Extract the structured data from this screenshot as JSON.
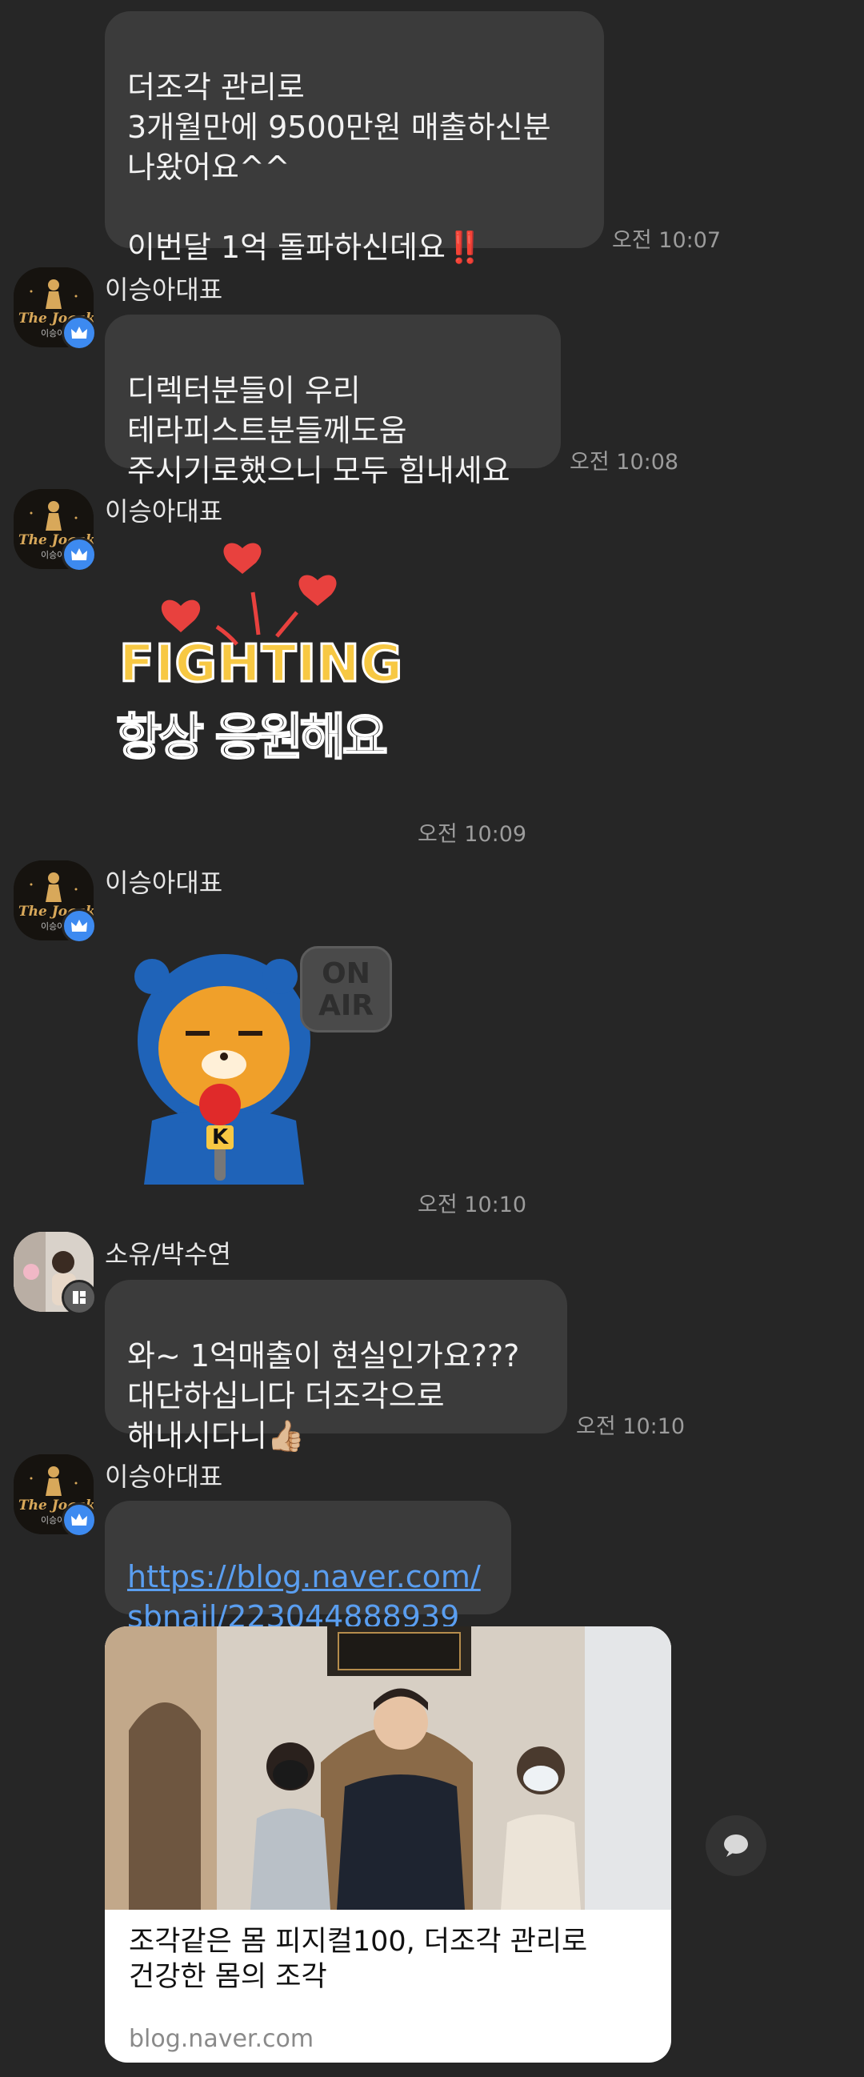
{
  "messages": {
    "m1": {
      "text": "더조각 관리로\n3개월만에 9500만원 매출하신분\n나왔어요^^\n\n이번달 1억 돌파하신데요",
      "emoji": "‼️",
      "time": "오전 10:07"
    },
    "m2": {
      "sender": "이승아대표",
      "text": "디렉터분들이 우리\n테라피스트분들께도움\n주시기로했으니 모두 힘내세요",
      "time": "오전 10:08"
    },
    "m3": {
      "sender": "이승아대표",
      "sticker_title": "FIGHTING",
      "sticker_sub": "항상 응원해요",
      "time": "오전 10:09"
    },
    "m4": {
      "sender": "이승아대표",
      "sticker_sign": "ON\nAIR",
      "sticker_mic_letter": "K",
      "time": "오전 10:10"
    },
    "m5": {
      "sender": "소유/박수연",
      "text": "와~ 1억매출이 현실인가요???\n대단하십니다 더조각으로\n해내시다니",
      "emoji": "👍🏼",
      "time": "오전 10:10"
    },
    "m6": {
      "sender": "이승아대표",
      "link": "https://blog.naver.com/\nsbnail/223044888939",
      "card_title": "조각같은 몸 피지컬100, 더조각 관리로\n건강한 몸의 조각",
      "card_domain": "blog.naver.com"
    }
  },
  "avatar": {
    "brand": "The Jogak",
    "sub": "이승아"
  },
  "colors": {
    "background": "#262626",
    "bubble": "#3b3b3b",
    "link": "#5a9ef0",
    "badge": "#3d8af0",
    "heart": "#e8413e",
    "sticker_yellow": "#f7c843"
  }
}
